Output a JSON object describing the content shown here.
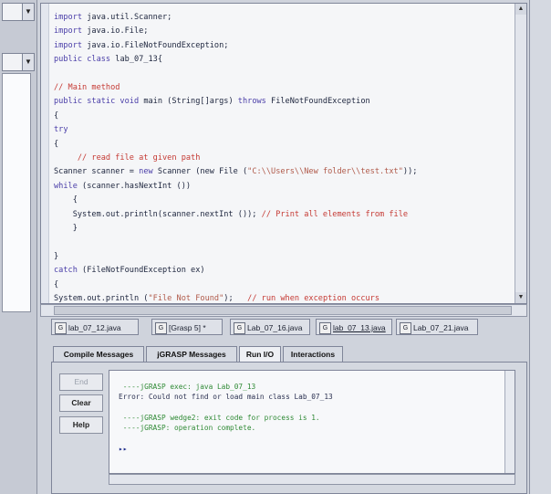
{
  "editor": {
    "lines": [
      [
        {
          "t": "import",
          "c": "kw"
        },
        {
          "t": " java.util.Scanner;"
        }
      ],
      [
        {
          "t": "import",
          "c": "kw"
        },
        {
          "t": " java.io.File;"
        }
      ],
      [
        {
          "t": "import",
          "c": "kw"
        },
        {
          "t": " java.io.FileNotFoundException;"
        }
      ],
      [
        {
          "t": "public class",
          "c": "kw"
        },
        {
          "t": " lab_07_13{"
        }
      ],
      [
        {
          "t": ""
        }
      ],
      [
        {
          "t": "// Main method",
          "c": "cm"
        }
      ],
      [
        {
          "t": "public static void",
          "c": "kw"
        },
        {
          "t": " main (String[]args) "
        },
        {
          "t": "throws",
          "c": "kw"
        },
        {
          "t": " FileNotFoundException"
        }
      ],
      [
        {
          "t": "{"
        }
      ],
      [
        {
          "t": "try",
          "c": "kw"
        }
      ],
      [
        {
          "t": "{"
        }
      ],
      [
        {
          "t": "     // read file at given path",
          "c": "cm"
        }
      ],
      [
        {
          "t": "Scanner scanner = "
        },
        {
          "t": "new",
          "c": "kw"
        },
        {
          "t": " Scanner (new File ("
        },
        {
          "t": "\"C:\\\\Users\\\\New folder\\\\test.txt\"",
          "c": "st"
        },
        {
          "t": "));"
        }
      ],
      [
        {
          "t": "while",
          "c": "kw"
        },
        {
          "t": " (scanner.hasNextInt ())"
        }
      ],
      [
        {
          "t": "    {"
        }
      ],
      [
        {
          "t": "    System.out.println(scanner.nextInt ()); "
        },
        {
          "t": "// Print all elements from file",
          "c": "cm"
        }
      ],
      [
        {
          "t": "    }"
        }
      ],
      [
        {
          "t": ""
        }
      ],
      [
        {
          "t": "}"
        }
      ],
      [
        {
          "t": "catch",
          "c": "kw"
        },
        {
          "t": " (FileNotFoundException ex)"
        }
      ],
      [
        {
          "t": "{"
        }
      ],
      [
        {
          "t": "System.out.println ("
        },
        {
          "t": "\"File Not Found\"",
          "c": "st"
        },
        {
          "t": ");   "
        },
        {
          "t": "// run when exception occurs",
          "c": "cm"
        }
      ],
      [
        {
          "t": "}"
        }
      ],
      [
        {
          "t": "}"
        }
      ]
    ]
  },
  "file_tabs": [
    {
      "label": "lab_07_12.java",
      "icon": "java-file-icon"
    },
    {
      "label": "[Grasp 5] *",
      "icon": "java-file-icon"
    },
    {
      "label": "Lab_07_16.java",
      "icon": "java-file-icon"
    },
    {
      "label": "lab_07_13.java",
      "icon": "java-file-icon",
      "active": true
    },
    {
      "label": "Lab_07_21.java",
      "icon": "java-file-icon"
    }
  ],
  "message_tabs": {
    "compile": "Compile Messages",
    "jgrasp": "jGRASP Messages",
    "run_io": "Run I/O",
    "interactions": "Interactions"
  },
  "side_buttons": {
    "end": "End",
    "clear": "Clear",
    "help": "Help"
  },
  "output": {
    "line1": " ----jGRASP exec: java Lab_07_13",
    "line2": "Error: Could not find or load main class Lab_07_13",
    "line3": " ----jGRASP wedge2: exit code for process is 1.",
    "line4": " ----jGRASP: operation complete.",
    "prompt": "▸▸"
  },
  "colors": {
    "keyword": "#4a3ea8",
    "comment": "#c53a34",
    "string": "#b05a4a",
    "output_green": "#2f8a35"
  }
}
